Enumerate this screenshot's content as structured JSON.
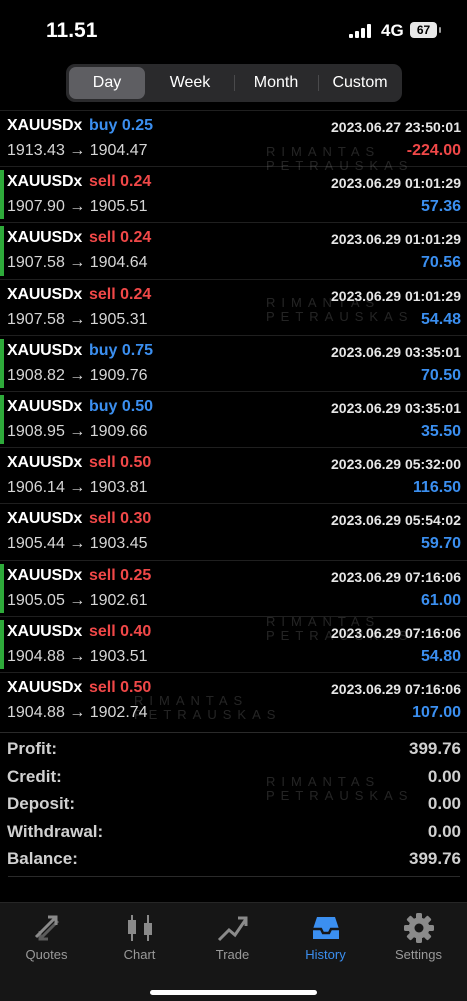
{
  "status_bar": {
    "time": "11.51",
    "network": "4G",
    "battery": "67"
  },
  "period_tabs": [
    {
      "label": "Day",
      "active": true
    },
    {
      "label": "Week",
      "active": false
    },
    {
      "label": "Month",
      "active": false
    },
    {
      "label": "Custom",
      "active": false
    }
  ],
  "trades": [
    {
      "symbol": "XAUUSDx",
      "action": "buy 0.25",
      "side": "buy",
      "datetime": "2023.06.27 23:50:01",
      "prices": "1913.43 → 1904.47",
      "profit": "-224.00",
      "marked": false
    },
    {
      "symbol": "XAUUSDx",
      "action": "sell 0.24",
      "side": "sell",
      "datetime": "2023.06.29 01:01:29",
      "prices": "1907.90 → 1905.51",
      "profit": "57.36",
      "marked": true
    },
    {
      "symbol": "XAUUSDx",
      "action": "sell 0.24",
      "side": "sell",
      "datetime": "2023.06.29 01:01:29",
      "prices": "1907.58 → 1904.64",
      "profit": "70.56",
      "marked": true
    },
    {
      "symbol": "XAUUSDx",
      "action": "sell 0.24",
      "side": "sell",
      "datetime": "2023.06.29 01:01:29",
      "prices": "1907.58 → 1905.31",
      "profit": "54.48",
      "marked": false
    },
    {
      "symbol": "XAUUSDx",
      "action": "buy 0.75",
      "side": "buy",
      "datetime": "2023.06.29 03:35:01",
      "prices": "1908.82 → 1909.76",
      "profit": "70.50",
      "marked": true
    },
    {
      "symbol": "XAUUSDx",
      "action": "buy 0.50",
      "side": "buy",
      "datetime": "2023.06.29 03:35:01",
      "prices": "1908.95 → 1909.66",
      "profit": "35.50",
      "marked": true
    },
    {
      "symbol": "XAUUSDx",
      "action": "sell 0.50",
      "side": "sell",
      "datetime": "2023.06.29 05:32:00",
      "prices": "1906.14 → 1903.81",
      "profit": "116.50",
      "marked": false
    },
    {
      "symbol": "XAUUSDx",
      "action": "sell 0.30",
      "side": "sell",
      "datetime": "2023.06.29 05:54:02",
      "prices": "1905.44 → 1903.45",
      "profit": "59.70",
      "marked": false
    },
    {
      "symbol": "XAUUSDx",
      "action": "sell 0.25",
      "side": "sell",
      "datetime": "2023.06.29 07:16:06",
      "prices": "1905.05 → 1902.61",
      "profit": "61.00",
      "marked": true
    },
    {
      "symbol": "XAUUSDx",
      "action": "sell 0.40",
      "side": "sell",
      "datetime": "2023.06.29 07:16:06",
      "prices": "1904.88 → 1903.51",
      "profit": "54.80",
      "marked": true
    },
    {
      "symbol": "XAUUSDx",
      "action": "sell 0.50",
      "side": "sell",
      "datetime": "2023.06.29 07:16:06",
      "prices": "1904.88 → 1902.74",
      "profit": "107.00",
      "marked": false
    }
  ],
  "summary": [
    {
      "label": "Profit:",
      "value": "399.76"
    },
    {
      "label": "Credit:",
      "value": "0.00"
    },
    {
      "label": "Deposit:",
      "value": "0.00"
    },
    {
      "label": "Withdrawal:",
      "value": "0.00"
    },
    {
      "label": "Balance:",
      "value": "399.76"
    }
  ],
  "tabs": [
    {
      "label": "Quotes",
      "icon": "quotes-arrows-icon",
      "active": false
    },
    {
      "label": "Chart",
      "icon": "candlestick-icon",
      "active": false
    },
    {
      "label": "Trade",
      "icon": "trend-line-icon",
      "active": false
    },
    {
      "label": "History",
      "icon": "inbox-tray-icon",
      "active": true
    },
    {
      "label": "Settings",
      "icon": "gear-icon",
      "active": false
    }
  ],
  "watermark": {
    "line1": "RIMANTAS",
    "line2": "PETRAUSKAS"
  },
  "colors": {
    "buy": "#3b8ff0",
    "sell": "#f04848",
    "accent": "#3b8ff0",
    "marker": "#2eaa3a"
  }
}
